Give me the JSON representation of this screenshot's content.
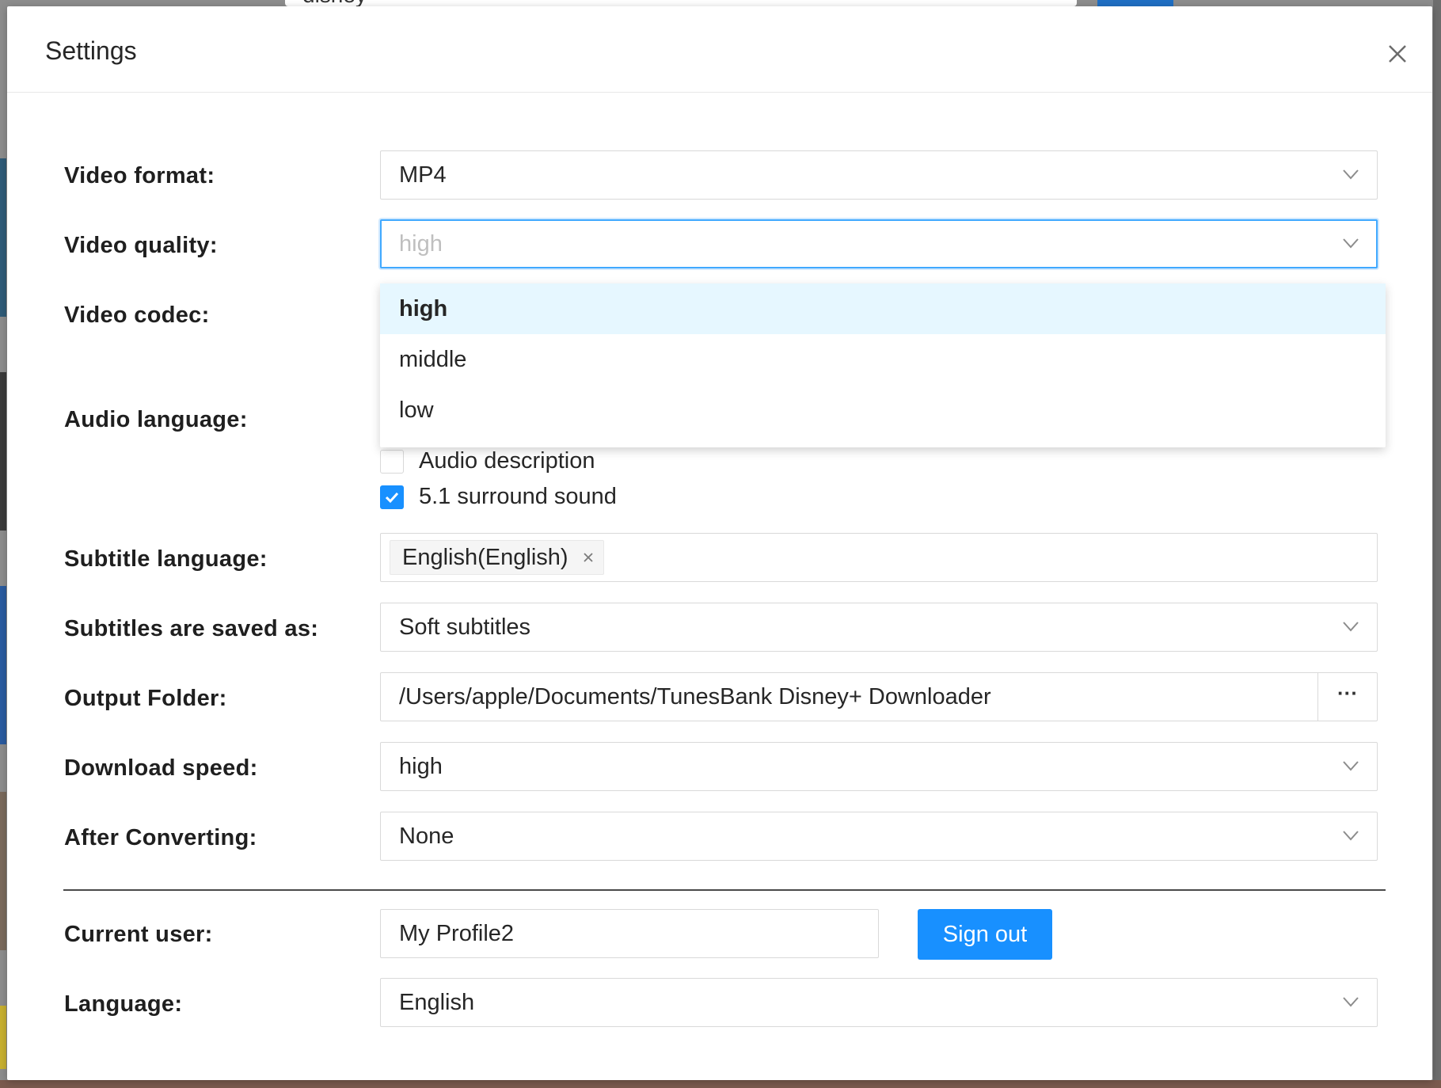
{
  "background": {
    "search_text": "disney"
  },
  "dialog": {
    "title": "Settings",
    "close_icon": "close-icon"
  },
  "fields": {
    "video_format": {
      "label": "Video format:",
      "value": "MP4"
    },
    "video_quality": {
      "label": "Video quality:",
      "placeholder": "high",
      "state": "open"
    },
    "video_codec": {
      "label": "Video codec:"
    },
    "audio_language": {
      "label": "Audio language:"
    },
    "audio_description": {
      "label": "Audio description",
      "checked": false
    },
    "surround_sound": {
      "label": "5.1 surround sound",
      "checked": true
    },
    "subtitle_language": {
      "label": "Subtitle language:",
      "tag": "English(English)"
    },
    "subtitles_saved_as": {
      "label": "Subtitles are saved as:",
      "value": "Soft subtitles"
    },
    "output_folder": {
      "label": "Output Folder:",
      "value": "/Users/apple/Documents/TunesBank Disney+ Downloader",
      "browse_label": "···"
    },
    "download_speed": {
      "label": "Download speed:",
      "value": "high"
    },
    "after_converting": {
      "label": "After Converting:",
      "value": "None"
    },
    "current_user": {
      "label": "Current user:",
      "value": "My Profile2"
    },
    "language": {
      "label": "Language:",
      "value": "English"
    }
  },
  "quality_dropdown": {
    "options": [
      "high",
      "middle",
      "low"
    ],
    "active": "high"
  },
  "buttons": {
    "sign_out": "Sign out"
  },
  "colors": {
    "accent": "#1890ff",
    "active_option_bg": "#e6f7ff",
    "focus_border": "#40a9ff"
  }
}
